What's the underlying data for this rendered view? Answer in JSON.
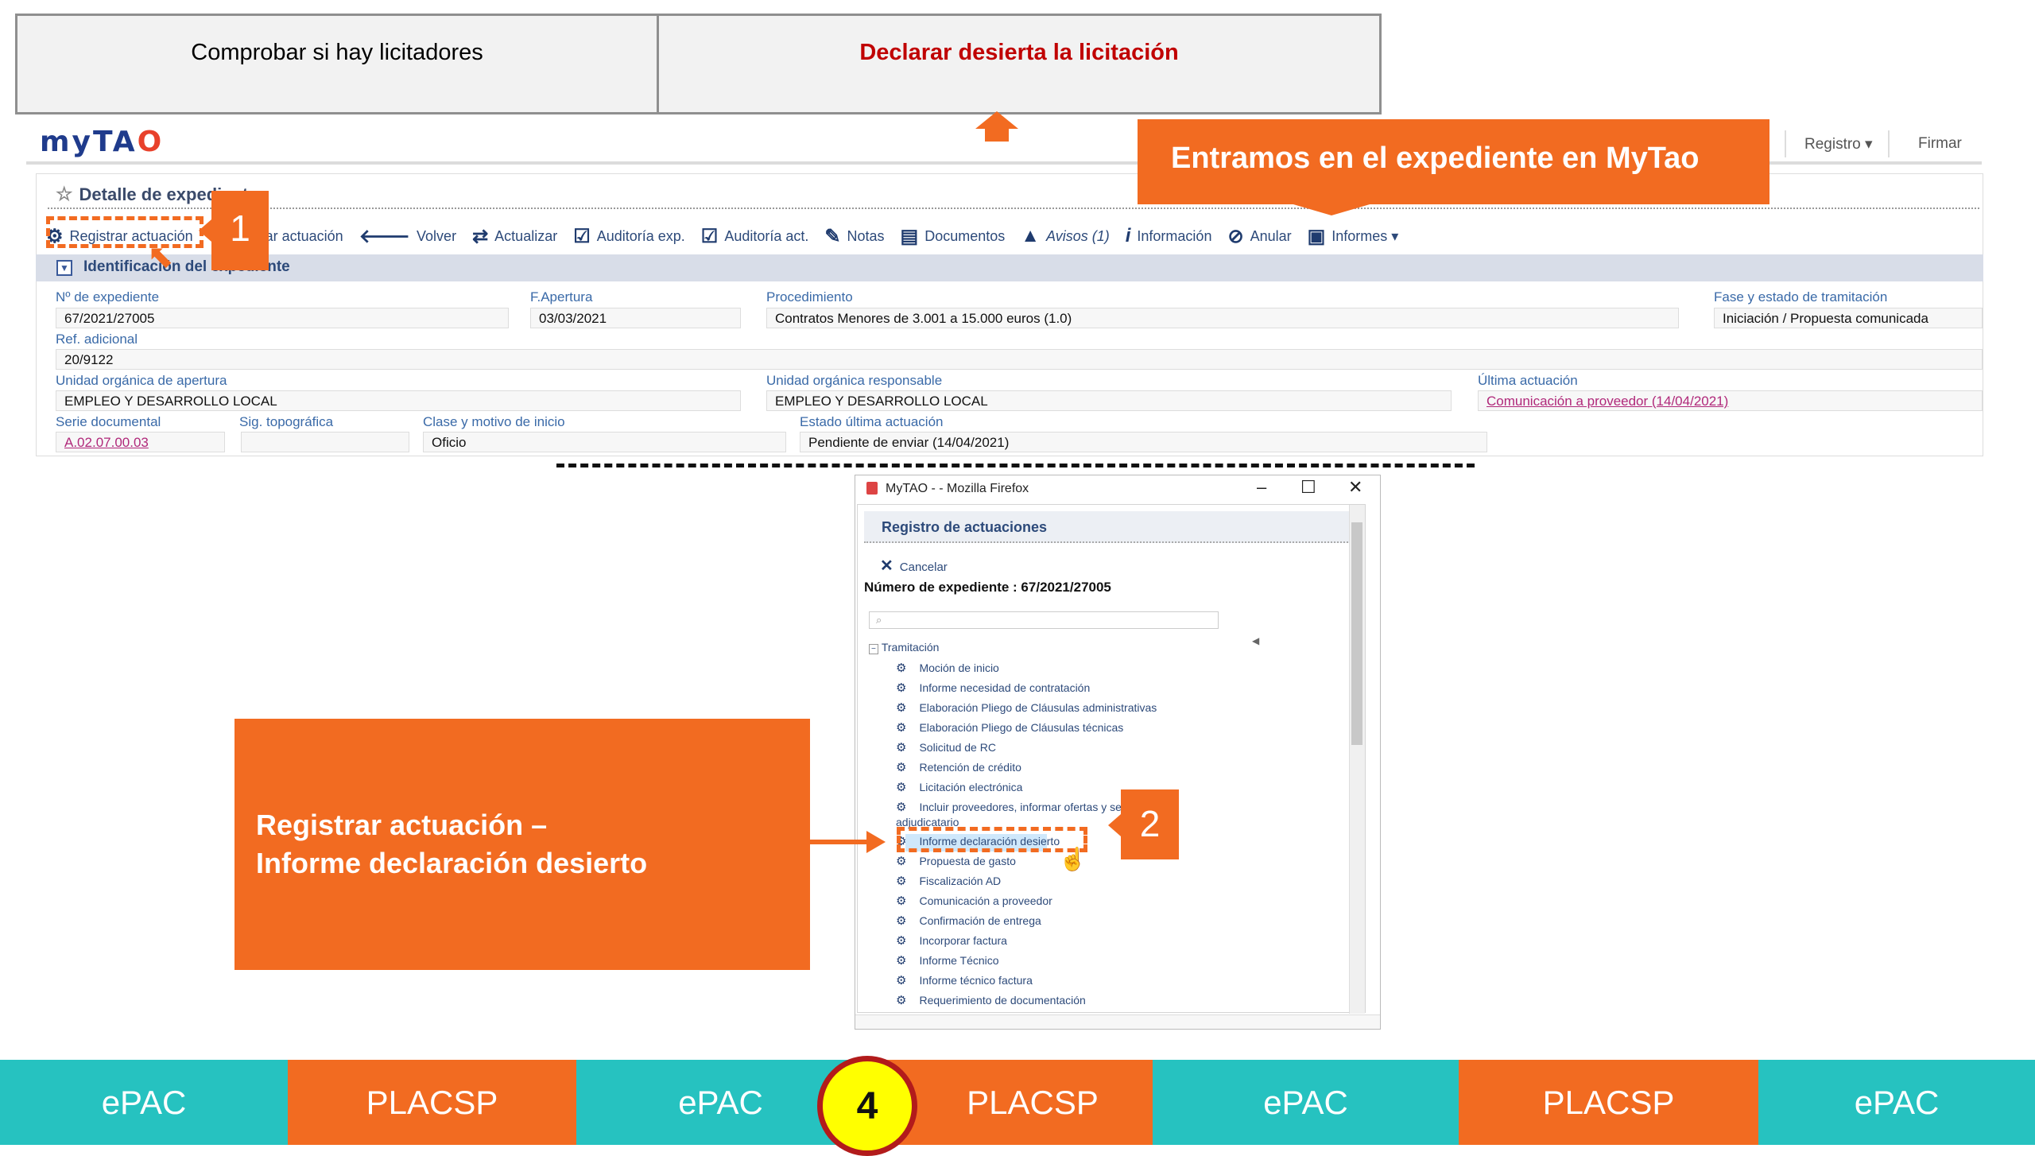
{
  "steps": {
    "left": "Comprobar si hay licitadores",
    "right": "Declarar desierta la licitación"
  },
  "header": {
    "logo_main": "myTA",
    "logo_accent": "O",
    "registro": "Registro ▾",
    "firmar": "Firmar"
  },
  "callout_top": "Entramos en el expediente en MyTao",
  "panel": {
    "title": "Detalle de expediente",
    "toolbar": [
      "Registrar actuación",
      "Cargar actuación",
      "Volver",
      "Actualizar",
      "Auditoría exp.",
      "Auditoría act.",
      "Notas",
      "Documentos",
      "Avisos (1)",
      "Información",
      "Anular",
      "Informes ▾"
    ],
    "section": "Identificación del expediente",
    "fields": {
      "num_exp_label": "Nº de expediente",
      "num_exp": "67/2021/27005",
      "f_apertura_label": "F.Apertura",
      "f_apertura": "03/03/2021",
      "procedimiento_label": "Procedimiento",
      "procedimiento": "Contratos Menores de 3.001 a 15.000 euros (1.0)",
      "fase_label": "Fase y estado de tramitación",
      "fase": "Iniciación / Propuesta comunicada",
      "ref_label": "Ref. adicional",
      "ref": "20/9122",
      "unidad_ap_label": "Unidad orgánica de apertura",
      "unidad_ap": "EMPLEO Y DESARROLLO LOCAL",
      "unidad_resp_label": "Unidad orgánica responsable",
      "unidad_resp": "EMPLEO Y DESARROLLO LOCAL",
      "ultima_label": "Última actuación",
      "ultima": "Comunicación a proveedor (14/04/2021)",
      "serie_label": "Serie documental",
      "serie": "A.02.07.00.03",
      "sig_label": "Sig. topográfica",
      "sig": "",
      "clase_label": "Clase y motivo de inicio",
      "clase": "Oficio",
      "estado_label": "Estado última actuación",
      "estado": "Pendiente de enviar (14/04/2021)"
    }
  },
  "badges": {
    "one": "1",
    "two": "2",
    "four": "4"
  },
  "window": {
    "title": "MyTAO - - Mozilla Firefox",
    "controls": [
      "–",
      "☐",
      "✕"
    ],
    "panel_title": "Registro de actuaciones",
    "cancel": "Cancelar",
    "expnum": "Número de expediente : 67/2021/27005",
    "search_placeholder": "",
    "tree_root": "Tramitación",
    "items": [
      "Moción de inicio",
      "Informe necesidad de contratación",
      "Elaboración Pliego de Cláusulas administrativas",
      "Elaboración Pliego de Cláusulas técnicas",
      "Solicitud de RC",
      "Retención de crédito",
      "Licitación electrónica",
      "Incluir proveedores, informar ofertas y selección adjudicatario",
      "Informe declaración desierto",
      "Propuesta de gasto",
      "Fiscalización AD",
      "Comunicación a proveedor",
      "Confirmación de entrega",
      "Incorporar factura",
      "Informe Técnico",
      "Informe técnico factura",
      "Requerimiento de documentación"
    ]
  },
  "callout_left": {
    "line1": "Registrar actuación –",
    "line2": "Informe declaración desierto"
  },
  "bottom": [
    "ePAC",
    "PLACSP",
    "ePAC",
    "PLACSP",
    "ePAC",
    "PLACSP",
    "ePAC"
  ],
  "colors": {
    "orange": "#f26b21",
    "teal": "#26c2c0",
    "red": "#c00000"
  }
}
